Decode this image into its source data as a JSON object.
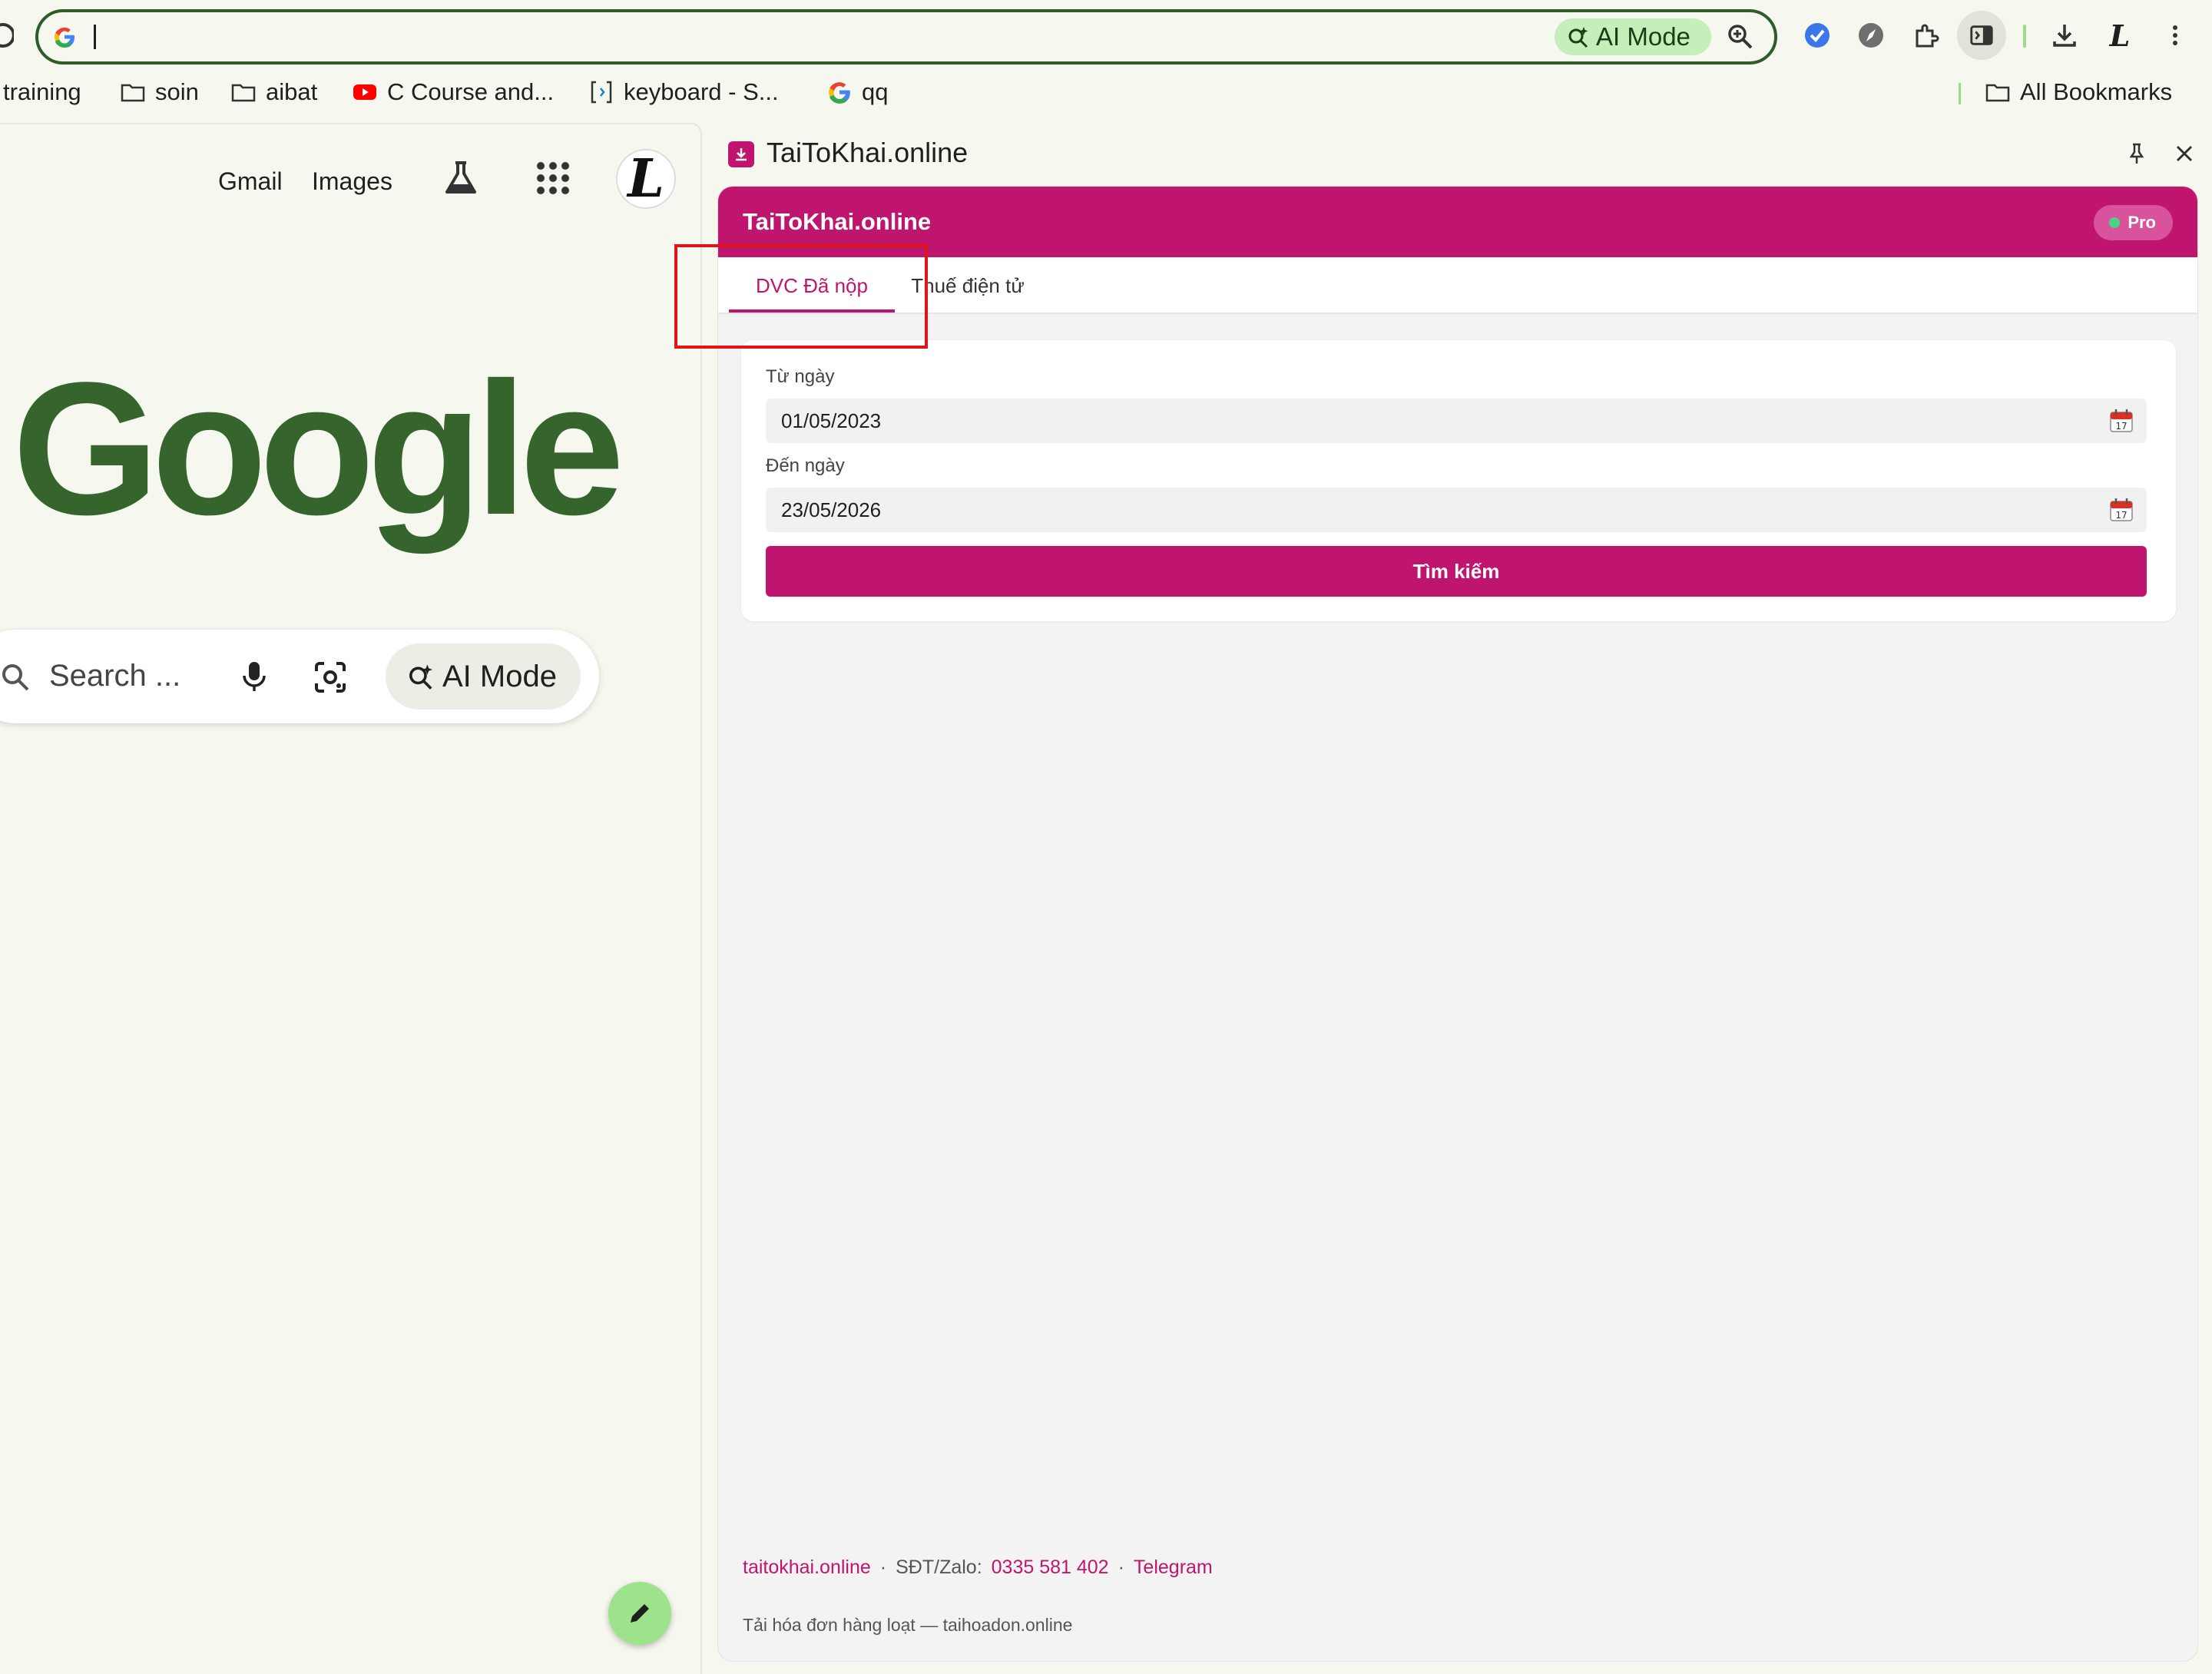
{
  "omnibox": {
    "value": "",
    "ai_mode_label": "AI Mode"
  },
  "bookmarks": [
    {
      "label": "training",
      "icon": "folder-icon"
    },
    {
      "label": "soin",
      "icon": "folder-icon"
    },
    {
      "label": "aibat",
      "icon": "folder-icon"
    },
    {
      "label": "C Course and...",
      "icon": "youtube-icon"
    },
    {
      "label": "keyboard - S...",
      "icon": "bracket-icon"
    },
    {
      "label": "qq",
      "icon": "google-icon"
    }
  ],
  "all_bookmarks": "All Bookmarks",
  "google": {
    "gmail": "Gmail",
    "images": "Images",
    "logo": "Google",
    "search_placeholder": "Search ...",
    "ai_mode": "AI Mode",
    "avatar_letter": "L"
  },
  "side_panel": {
    "title": "TaiToKhai.online",
    "ext": {
      "title": "TaiToKhai.online",
      "badge": "Pro",
      "tabs": [
        {
          "label": "DVC Đã nộp",
          "active": true
        },
        {
          "label": "Thuế điện tử",
          "active": false
        }
      ],
      "from_label": "Từ ngày",
      "from_value": "01/05/2023",
      "to_label": "Đến ngày",
      "to_value": "23/05/2026",
      "search_button": "Tìm kiếm",
      "footer": {
        "site": "taitokhai.online",
        "sep1": "·",
        "phone_label": "SĐT/Zalo:",
        "phone": "0335 581 402",
        "sep2": "·",
        "telegram": "Telegram",
        "tagline": "Tải hóa đơn hàng loạt — taihoadon.online"
      }
    }
  },
  "colors": {
    "brand": "#c0156f",
    "google_green": "#35652c",
    "highlight": "#e0151a"
  }
}
